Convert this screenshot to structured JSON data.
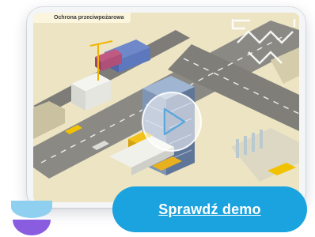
{
  "video": {
    "title": "Ochrona przeciwpożarowa"
  },
  "cta": {
    "label": "Sprawdź demo"
  },
  "icons": {
    "play": "play-icon",
    "brand": "brand-logo-icon"
  },
  "colors": {
    "accent": "#1aa3df",
    "brand_top": "#8fd0f0",
    "brand_bottom": "#8a5ce0"
  }
}
